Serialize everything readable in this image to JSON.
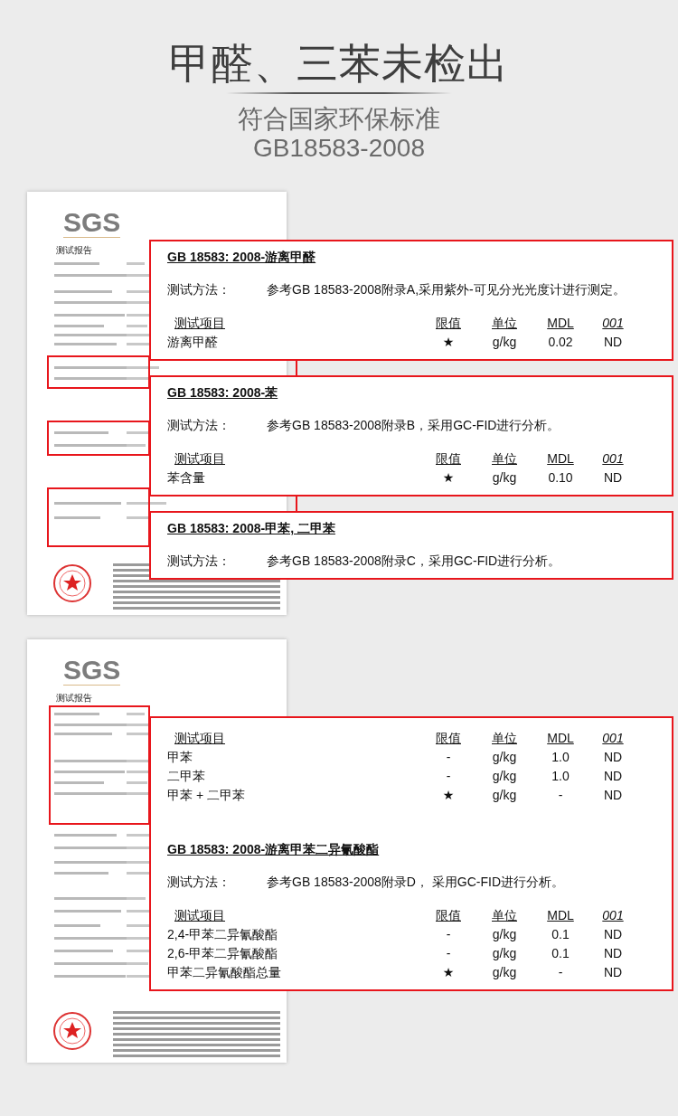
{
  "header": {
    "title": "甲醛、三苯未检出",
    "subtitle": "符合国家环保标准",
    "standard": "GB18583-2008"
  },
  "reports": [
    {
      "logo": "SGS",
      "heading": "测试报告",
      "callouts": [
        {
          "sections": [
            {
              "title": "GB 18583: 2008-游离甲醛",
              "method_label": "测试方法：",
              "method": "参考GB 18583-2008附录A,采用紫外-可见分光光度计进行测定。",
              "columns": [
                "测试项目",
                "限值",
                "单位",
                "MDL",
                "001"
              ],
              "rows": [
                {
                  "item": "游离甲醛",
                  "limit": "★",
                  "unit": "g/kg",
                  "mdl": "0.02",
                  "result": "ND"
                }
              ]
            }
          ]
        },
        {
          "sections": [
            {
              "title": "GB 18583: 2008-苯",
              "method_label": "测试方法：",
              "method": "参考GB 18583-2008附录B，采用GC-FID进行分析。",
              "columns": [
                "测试项目",
                "限值",
                "单位",
                "MDL",
                "001"
              ],
              "rows": [
                {
                  "item": "苯含量",
                  "limit": "★",
                  "unit": "g/kg",
                  "mdl": "0.10",
                  "result": "ND"
                }
              ]
            }
          ]
        },
        {
          "sections": [
            {
              "title": "GB 18583: 2008-甲苯, 二甲苯",
              "method_label": "测试方法：",
              "method": "参考GB 18583-2008附录C，采用GC-FID进行分析。"
            }
          ]
        }
      ]
    },
    {
      "logo": "SGS",
      "heading": "测试报告",
      "callouts": [
        {
          "sections": [
            {
              "columns": [
                "测试项目",
                "限值",
                "单位",
                "MDL",
                "001"
              ],
              "rows": [
                {
                  "item": "甲苯",
                  "limit": "-",
                  "unit": "g/kg",
                  "mdl": "1.0",
                  "result": "ND"
                },
                {
                  "item": "二甲苯",
                  "limit": "-",
                  "unit": "g/kg",
                  "mdl": "1.0",
                  "result": "ND"
                },
                {
                  "item": "甲苯 + 二甲苯",
                  "limit": "★",
                  "unit": "g/kg",
                  "mdl": "-",
                  "result": "ND"
                }
              ]
            },
            {
              "title": "GB 18583: 2008-游离甲苯二异氰酸酯",
              "method_label": "测试方法：",
              "method": "参考GB 18583-2008附录D， 采用GC-FID进行分析。",
              "columns": [
                "测试项目",
                "限值",
                "单位",
                "MDL",
                "001"
              ],
              "rows": [
                {
                  "item": "2,4-甲苯二异氰酸酯",
                  "limit": "-",
                  "unit": "g/kg",
                  "mdl": "0.1",
                  "result": "ND"
                },
                {
                  "item": "2,6-甲苯二异氰酸酯",
                  "limit": "-",
                  "unit": "g/kg",
                  "mdl": "0.1",
                  "result": "ND"
                },
                {
                  "item": "甲苯二异氰酸酯总量",
                  "limit": "★",
                  "unit": "g/kg",
                  "mdl": "-",
                  "result": "ND"
                }
              ]
            }
          ]
        }
      ]
    }
  ]
}
